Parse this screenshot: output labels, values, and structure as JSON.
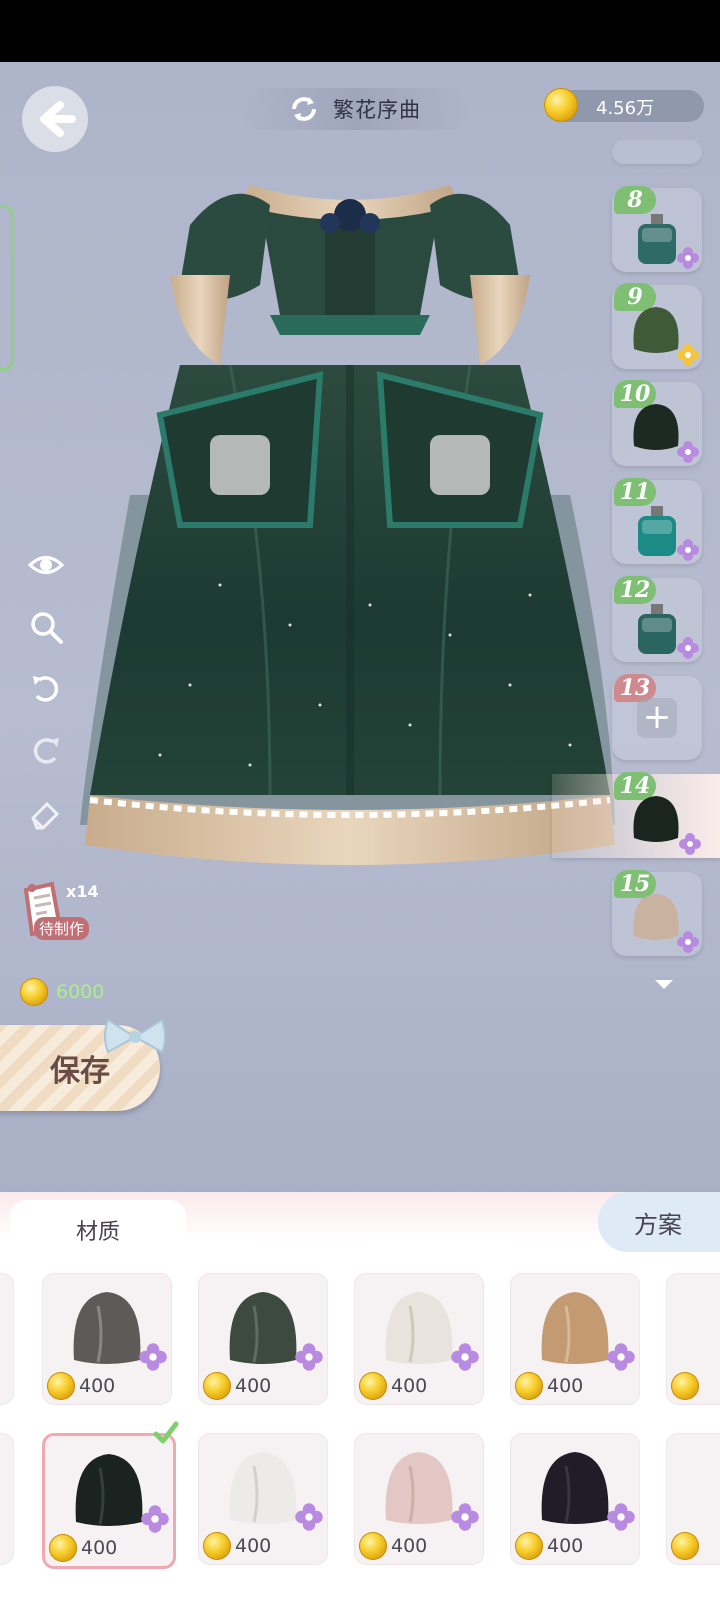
{
  "header": {
    "title": "繁花序曲",
    "currency": "4.56万"
  },
  "left_panel": {
    "todo_count": "x14",
    "todo_label": "待制作",
    "cost": "6000",
    "save_label": "保存"
  },
  "slots": [
    {
      "num": "8",
      "kind": "bottle",
      "color": "#2f6b66",
      "badge": "purple"
    },
    {
      "num": "9",
      "kind": "fabric",
      "color": "#3f5a37",
      "badge": "gold"
    },
    {
      "num": "10",
      "kind": "fabric",
      "color": "#1d2a22",
      "badge": "purple"
    },
    {
      "num": "11",
      "kind": "bottle",
      "color": "#1c8a85",
      "badge": "purple"
    },
    {
      "num": "12",
      "kind": "bottle",
      "color": "#2a6560",
      "badge": "purple"
    },
    {
      "num": "13",
      "kind": "empty",
      "color": "",
      "badge": ""
    },
    {
      "num": "14",
      "kind": "fabric",
      "color": "#1b2520",
      "badge": "purple",
      "selected": true
    },
    {
      "num": "15",
      "kind": "fabric",
      "color": "#c9b3a0",
      "badge": "purple"
    }
  ],
  "tabs": {
    "material": "材质",
    "plan": "方案"
  },
  "materials_row1": [
    {
      "price": "400",
      "color": "#5e5a58"
    },
    {
      "price": "400",
      "color": "#3c4a40"
    },
    {
      "price": "400",
      "color": "#e8e3dc"
    },
    {
      "price": "400",
      "color": "#c49a72"
    }
  ],
  "materials_row2": [
    {
      "price": "400",
      "color": "#1a2320",
      "selected": true
    },
    {
      "price": "400",
      "color": "#ecebea"
    },
    {
      "price": "400",
      "color": "#e3c7c4"
    },
    {
      "price": "400",
      "color": "#221c28"
    }
  ],
  "colors": {
    "accent_green": "#7fbf73",
    "accent_pink": "#f0a8b2",
    "coin": "#f7cd2a"
  }
}
